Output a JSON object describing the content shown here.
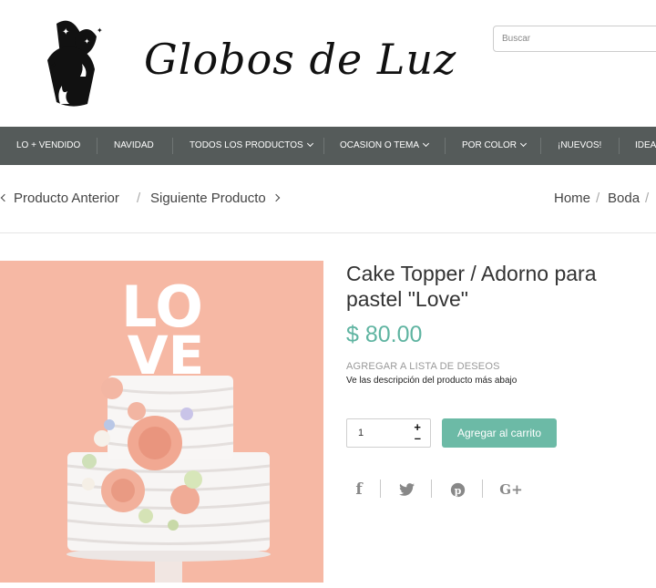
{
  "header": {
    "brand": "Globos de Luz",
    "search_placeholder": "Buscar"
  },
  "nav": {
    "items": [
      {
        "label": "LO + VENDIDO",
        "dropdown": false
      },
      {
        "label": "NAVIDAD",
        "dropdown": false
      },
      {
        "label": "TODOS LOS PRODUCTOS",
        "dropdown": true
      },
      {
        "label": "OCASION O TEMA",
        "dropdown": true
      },
      {
        "label": "POR COLOR",
        "dropdown": true
      },
      {
        "label": "¡NUEVOS!",
        "dropdown": false
      },
      {
        "label": "IDEA",
        "dropdown": false
      }
    ]
  },
  "product_nav": {
    "prev": "Producto Anterior",
    "next": "Siguiente Producto",
    "separator": "/"
  },
  "breadcrumb": {
    "home": "Home",
    "current": "Boda",
    "separator": "/"
  },
  "product": {
    "title": "Cake Topper / Adorno para pastel \"Love\"",
    "price": "$ 80.00",
    "wishlist": "AGREGAR A LISTA DE DESEOS",
    "description_note": "Ve las descripción del producto más abajo",
    "quantity": "1",
    "add_to_cart": "Agregar al carrito",
    "topper_word": "LOVE"
  },
  "share": {
    "icons": [
      "facebook-icon",
      "twitter-icon",
      "pinterest-icon",
      "google-plus-icon"
    ],
    "labels": [
      "f",
      "G+"
    ]
  },
  "colors": {
    "nav_bg": "#555b5a",
    "accent": "#6cbaa6",
    "price": "#5fb4a1",
    "image_bg": "#f5b7a3"
  }
}
